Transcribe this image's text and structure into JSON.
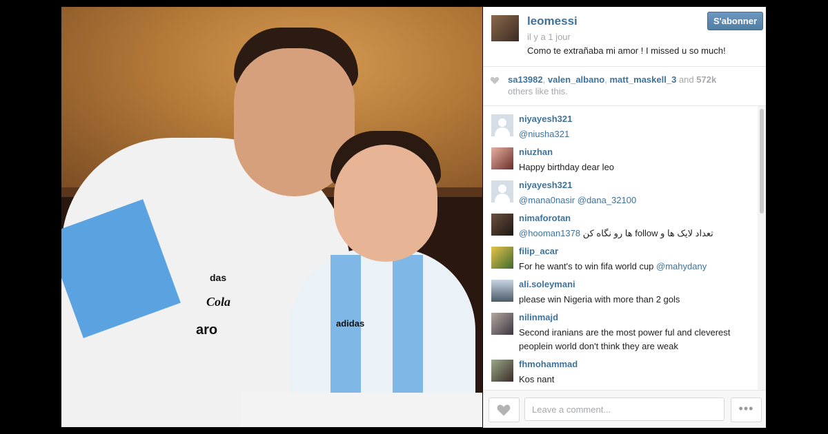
{
  "post": {
    "username": "leomessi",
    "time_ago": "il y a 1 jour",
    "caption": "Como te extrañaba mi amor ! I missed u so much!",
    "follow_label": "S'abonner"
  },
  "likes": {
    "users": [
      "sa13982",
      "valen_albano",
      "matt_maskell_3"
    ],
    "sep": ", ",
    "and_label": "and",
    "count": "572k",
    "suffix": "others like this."
  },
  "photo": {
    "brands": {
      "adidas_man": "das",
      "cola": "Cola",
      "aro": "aro",
      "adidas_kid": "adidas"
    }
  },
  "comments": [
    {
      "user": "niyayesh321",
      "text": "",
      "mentions": [
        "@niusha321"
      ],
      "avatar": "default"
    },
    {
      "user": "niuzhan",
      "text": "Happy birthday dear leo",
      "mentions": [],
      "avatar": "photo"
    },
    {
      "user": "niyayesh321",
      "text": "",
      "mentions": [
        "@mana0nasir",
        "@dana_32100"
      ],
      "avatar": "default"
    },
    {
      "user": "nimaforotan",
      "text": "ها رو نگاه کن follow تعداد لایک ها و",
      "mentions": [
        "@hooman1378"
      ],
      "avatar": "photo"
    },
    {
      "user": "filip_acar",
      "text": "For he want's to win fifa world cup",
      "mentions": [
        "@mahydany"
      ],
      "avatar": "photo"
    },
    {
      "user": "ali.soleymani",
      "text": "please win Nigeria with more than 2 gols",
      "mentions": [],
      "avatar": "photo"
    },
    {
      "user": "nilinmajd",
      "text": "Second iranians are the most power ful and cleverest peoplein world don't think they are weak",
      "mentions": [],
      "avatar": "photo"
    },
    {
      "user": "fhmohammad",
      "text": "Kos nant",
      "mentions": [],
      "avatar": "photo"
    }
  ],
  "footer": {
    "comment_placeholder": "Leave a comment...",
    "more_label": "•••"
  },
  "colors": {
    "link": "#3f729b",
    "muted": "#a5a7aa",
    "follow_button": "#517fa4",
    "background": "#000000"
  },
  "icons": {
    "like": "heart-icon",
    "more": "ellipsis-icon",
    "default_avatar": "user-silhouette-icon"
  }
}
